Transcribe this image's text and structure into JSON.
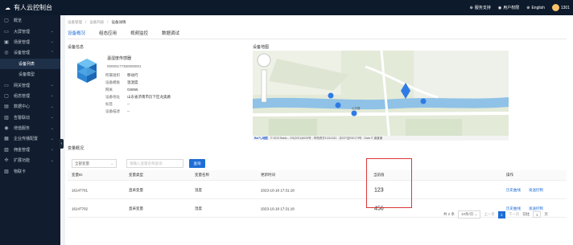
{
  "header": {
    "logo_text": "有人云控制台",
    "support": "服务支持",
    "user_manual": "用户权限",
    "language": "English",
    "user": "1301"
  },
  "sidebar": {
    "items": [
      {
        "icon": "▢",
        "label": "概览",
        "chev": ""
      },
      {
        "icon": "▭",
        "label": "大屏管理",
        "chev": "⌄"
      },
      {
        "icon": "▣",
        "label": "场景管理",
        "chev": "⌄"
      },
      {
        "icon": "◎",
        "label": "设备管理",
        "chev": "⌃"
      }
    ],
    "subitems": [
      {
        "label": "设备列表"
      },
      {
        "label": "设备模型"
      }
    ],
    "items2": [
      {
        "icon": "▭",
        "label": "网关管理",
        "chev": "⌄"
      },
      {
        "icon": "▢",
        "label": "组态管理",
        "chev": "⌄"
      },
      {
        "icon": "▤",
        "label": "数据中心",
        "chev": "⌄"
      },
      {
        "icon": "▥",
        "label": "告警联动",
        "chev": "⌄"
      },
      {
        "icon": "◉",
        "label": "增值服务",
        "chev": "⌄"
      },
      {
        "icon": "▦",
        "label": "企业传播配置",
        "chev": "⌄"
      },
      {
        "icon": "▧",
        "label": "佣金管理",
        "chev": "⌄"
      },
      {
        "icon": "✣",
        "label": "扩展功能",
        "chev": "⌄"
      },
      {
        "icon": "▨",
        "label": "物联卡",
        "chev": ""
      }
    ],
    "collapse": "‹"
  },
  "breadcrumb": {
    "l1": "设备管理",
    "sep": "/",
    "l2": "设备列表",
    "l3": "设备详情"
  },
  "tabs": [
    {
      "label": "设备概况",
      "active": true
    },
    {
      "label": "组态应用",
      "active": false
    },
    {
      "label": "视频监控",
      "active": false
    },
    {
      "label": "数据调试",
      "active": false
    }
  ],
  "device_info": {
    "title": "设备信息",
    "name": "温湿度传感器",
    "id": "00000177350000001",
    "fields": [
      {
        "k": "所属组织",
        "v": "移动行"
      },
      {
        "k": "设备模板",
        "v": "温湿度"
      },
      {
        "k": "网关",
        "v": "G8065"
      },
      {
        "k": "设备地址",
        "v": "山东省济南市历下区龙奥路"
      },
      {
        "k": "标签",
        "v": "--"
      },
      {
        "k": "设备描述",
        "v": "--"
      }
    ]
  },
  "map": {
    "title": "设备地图",
    "copyright": "© 2023 Baidu - GS(2021)6026号 - 甲测资字11111342 - 京ICP证030173号 - Data © 道道通",
    "brand": "Bai",
    "brand2": "地图",
    "road": "公交路"
  },
  "variables": {
    "title": "变量概况",
    "filter_value": "全部变量",
    "search_placeholder": "请输入变量名称查询",
    "search_btn": "查询",
    "columns": [
      "变量ID",
      "变量类型",
      "变量名称",
      "更新时间",
      "当前值",
      "操作"
    ],
    "rows": [
      {
        "id": "16147701",
        "type": "直采变量",
        "name": "温度",
        "time": "2023-10-18 17:31:18",
        "value": "123",
        "op1": "历史曲线",
        "op2": "发送控制"
      },
      {
        "id": "16147702",
        "type": "直采变量",
        "name": "湿度",
        "time": "2023-10-18 17:31:18",
        "value": "456",
        "op1": "历史曲线",
        "op2": "发送控制"
      }
    ]
  },
  "pager": {
    "total": "共 2 条",
    "size": "10条/页",
    "prev": "上一页",
    "page": "1",
    "next": "下一页",
    "goto": "前往",
    "goto_value": "1",
    "page_unit": "页"
  }
}
